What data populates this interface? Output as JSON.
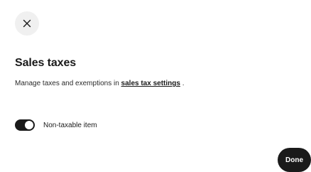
{
  "header": {
    "close_icon": "close-icon"
  },
  "section": {
    "title": "Sales taxes",
    "description_prefix": "Manage taxes and exemptions in ",
    "description_link": "sales tax settings",
    "description_suffix": " ."
  },
  "toggle": {
    "label": "Non-taxable item",
    "state": "on"
  },
  "footer": {
    "done_label": "Done"
  },
  "colors": {
    "primary_dark": "#1a1a1a",
    "close_bg": "#f0f0f0",
    "background": "#ffffff"
  }
}
